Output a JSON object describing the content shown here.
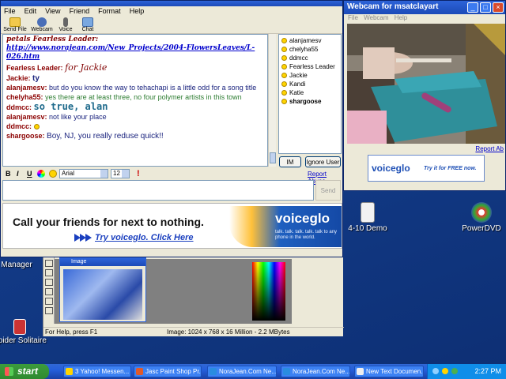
{
  "chat_window": {
    "menu": [
      "File",
      "Edit",
      "View",
      "Friend",
      "Format",
      "Help"
    ],
    "toolbar": [
      {
        "label": "Send File",
        "icon": "folder-icon"
      },
      {
        "label": "Webcam",
        "icon": "webcam-icon"
      },
      {
        "label": "Voice",
        "icon": "microphone-icon"
      },
      {
        "label": "Chat",
        "icon": "chat-icon"
      }
    ],
    "messages": {
      "petals_line": "petals Fearless Leader:",
      "petals_url": "http://www.norajean.com/New_Projects/2004-FlowersLeaves/L-026.htm",
      "fl_name": "Fearless Leader:",
      "fl_text": "for Jackie",
      "jackie_name": "Jackie:",
      "jackie_text": "ty",
      "alan1_name": "alanjamesv:",
      "alan1_text": "but do you know the way to tehachapi is a little odd for a song title",
      "chelyha_name": "chelyha55:",
      "chelyha_text": "yes there are at least three, no four polymer artists in this town",
      "ddmcc1_name": "ddmcc:",
      "ddmcc1_text": "so true, alan",
      "alan2_name": "alanjamesv:",
      "alan2_text": "not like your place",
      "ddmcc2_name": "ddmcc:",
      "shargoose_name": "shargoose:",
      "shargoose_text": "Boy, NJ, you really reduse quick!!"
    },
    "users": [
      "alanjamesv",
      "chelyha55",
      "ddmcc",
      "Fearless Leader",
      "Jackie",
      "Kandi",
      "Katie",
      "shargoose"
    ],
    "im_button": "IM",
    "ignore_button": "Ignore User",
    "report_abuse": "Report Abuse",
    "format": {
      "bold": "B",
      "italic": "I",
      "underline": "U",
      "font": "Arial",
      "size": "12"
    },
    "send_button": "Send",
    "ad": {
      "headline": "Call your friends for next to nothing.",
      "link": "Try voiceglo. Click Here",
      "brand": "voiceglo",
      "tagline": "talk. talk. talk. talk. talk to any phone in the world."
    }
  },
  "webcam_window": {
    "title": "Webcam for msatclayart",
    "menu": [
      "File",
      "Webcam",
      "Help"
    ],
    "report_abuse": "Report Ab",
    "ad_brand": "voiceglo",
    "ad_text": "Try it for FREE now."
  },
  "paint_shop": {
    "thumb_title": "Image",
    "status_help": "For Help, press F1",
    "status_image": "Image:  1024 x 768 x 16 Million - 2.2 MBytes"
  },
  "desktop_icons": [
    {
      "label": "4-10 Demo"
    },
    {
      "label": "PowerDVD"
    },
    {
      "label": "Manager"
    },
    {
      "label": "Spider Solitaire"
    }
  ],
  "taskbar": {
    "start": "start",
    "tasks": [
      "3 Yahoo! Messen...",
      "Jasc Paint Shop Pr...",
      "NoraJean.Com Ne...",
      "NoraJean.Com Ne...",
      "New Text Documen..."
    ],
    "clock": "2:27 PM"
  },
  "colors": {
    "titlebar": "#2d63d8",
    "desktop": "#123a86",
    "username": "#8b0000",
    "link": "#0000cc"
  }
}
